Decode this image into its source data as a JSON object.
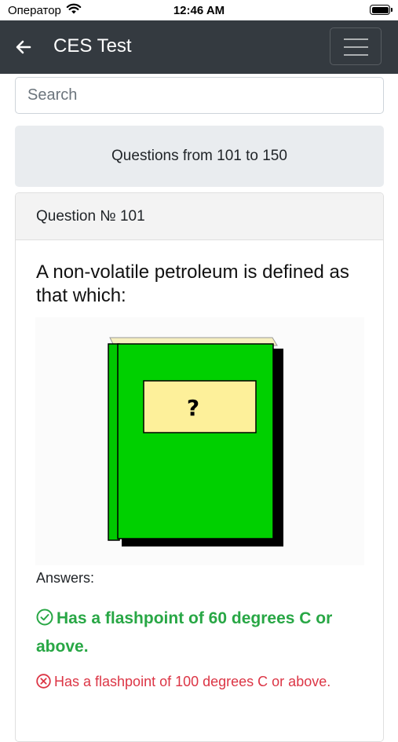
{
  "status_bar": {
    "carrier": "Оператор",
    "time": "12:46 AM",
    "wifi_icon": "wifi-icon",
    "battery_icon": "battery-icon"
  },
  "navbar": {
    "title": "CES Test",
    "back_icon": "back-arrow-icon",
    "menu_icon": "hamburger-menu-icon",
    "background": "#343a40"
  },
  "search": {
    "placeholder": "Search",
    "value": ""
  },
  "range": {
    "label": "Questions from 101 to 150"
  },
  "question": {
    "header": "Question № 101",
    "text": "A non-volatile petroleum is defined as that which:",
    "image_icon": "book-question-icon",
    "answers_label": "Answers:",
    "answers": [
      {
        "text": "Has a flashpoint of 60 degrees C or above.",
        "correct": true,
        "icon": "check-circle-icon"
      },
      {
        "text": "Has a flashpoint of 100 degrees C or above.",
        "correct": false,
        "icon": "x-circle-icon"
      }
    ]
  },
  "colors": {
    "correct": "#28a745",
    "wrong": "#dc3545",
    "book_green": "#00d000",
    "book_label": "#fdf09a"
  }
}
